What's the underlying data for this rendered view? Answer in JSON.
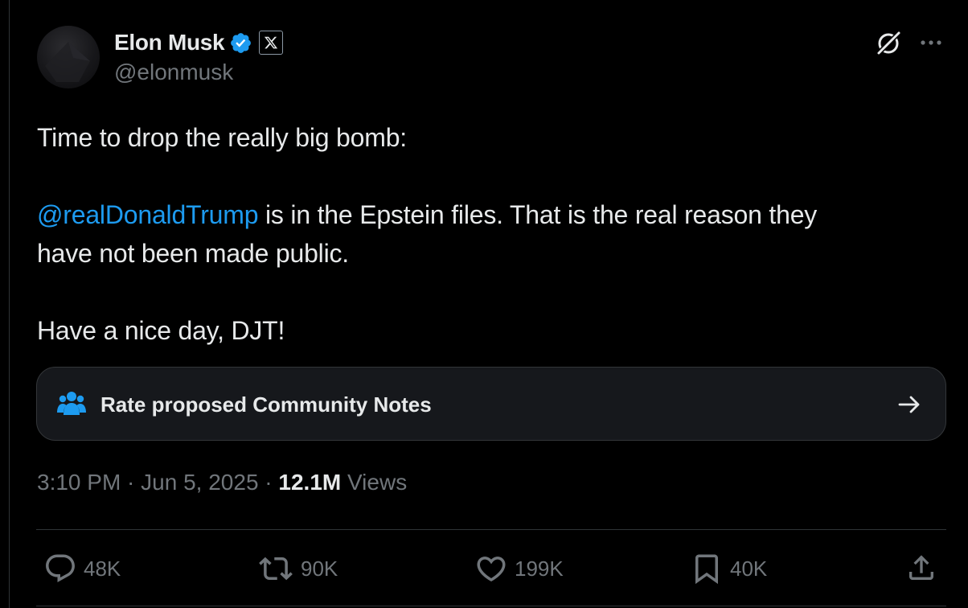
{
  "author": {
    "display_name": "Elon Musk",
    "handle": "@elonmusk",
    "verified_badge_color": "#1d9bf0"
  },
  "header_icons": {
    "grok": "grok-icon",
    "more": "more-icon"
  },
  "tweet": {
    "line1": "Time to drop the really big bomb:",
    "mention": "@realDonaldTrump",
    "line2_rest": " is in the Epstein files. That is the real reason they",
    "line3": "have not been made public.",
    "line4": "Have a nice day, DJT!"
  },
  "community_notes": {
    "label": "Rate proposed Community Notes",
    "icon": "people-group-icon",
    "arrow": "arrow-right-icon"
  },
  "meta": {
    "time": "3:10 PM",
    "separator1": " · ",
    "date": "Jun 5, 2025",
    "separator2": " · ",
    "views_count": "12.1M",
    "views_label": " Views"
  },
  "actions": {
    "replies": "48K",
    "reposts": "90K",
    "likes": "199K",
    "bookmarks": "40K"
  },
  "colors": {
    "background": "#000000",
    "text_primary": "#e7e9ea",
    "text_secondary": "#71767b",
    "link": "#1d9bf0",
    "border": "#2f3336",
    "card_bg": "#16181c"
  }
}
